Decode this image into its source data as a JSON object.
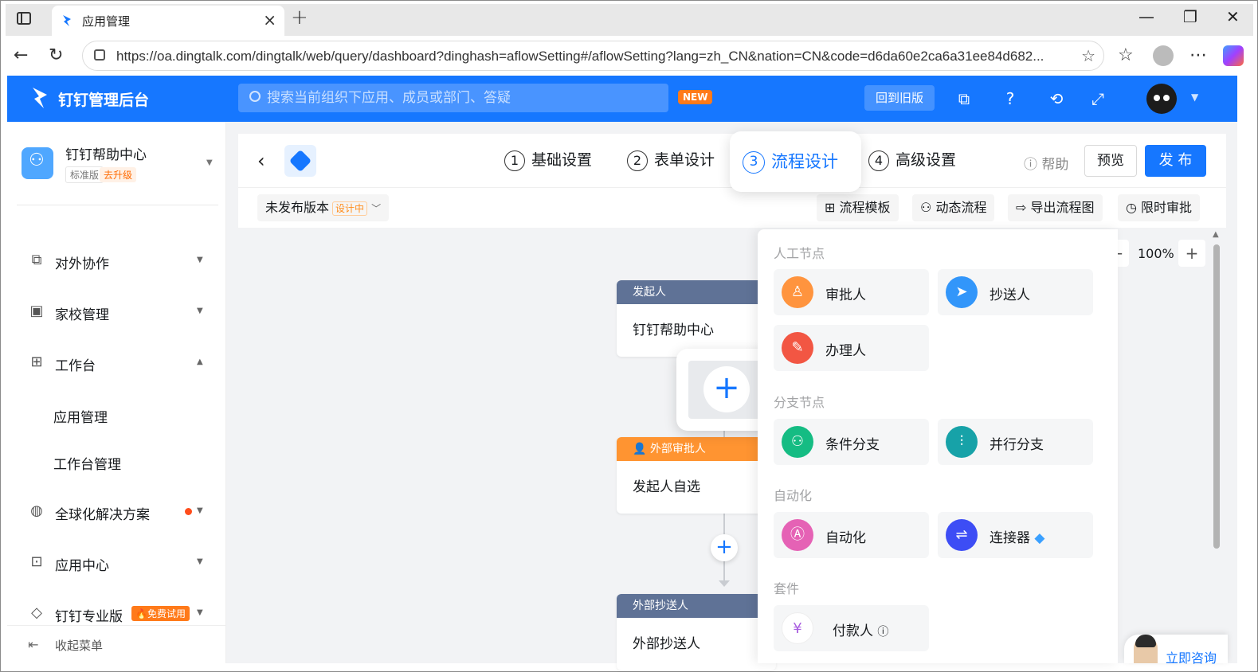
{
  "browser": {
    "tab_title": "应用管理",
    "url": "https://oa.dingtalk.com/dingtalk/web/query/dashboard?dinghash=aflowSetting#/aflowSetting?lang=zh_CN&nation=CN&code=d6da60e2ca6a31ee84d682..."
  },
  "header": {
    "app_title": "钉钉管理后台",
    "search_placeholder": "搜索当前组织下应用、成员或部门、答疑",
    "new_badge": "NEW",
    "old_version_label": "回到旧版",
    "brand_color": "#1677ff"
  },
  "sidebar": {
    "org_name": "钉钉帮助中心",
    "edition": "标准版",
    "upgrade": "去升级",
    "items": [
      {
        "label": "对外协作",
        "icon": "share-icon"
      },
      {
        "label": "家校管理",
        "icon": "school-icon"
      },
      {
        "label": "工作台",
        "icon": "grid-icon"
      },
      {
        "label": "全球化解决方案",
        "icon": "globe-icon"
      },
      {
        "label": "应用中心",
        "icon": "apps-icon"
      },
      {
        "label": "钉钉专业版",
        "icon": "diamond-icon"
      }
    ],
    "sub_items": [
      "应用管理",
      "工作台管理"
    ],
    "trial_badge": "🔥免费试用",
    "collapse_label": "收起菜单"
  },
  "editor": {
    "steps": [
      {
        "num": "1",
        "label": "基础设置"
      },
      {
        "num": "2",
        "label": "表单设计"
      },
      {
        "num": "3",
        "label": "流程设计"
      },
      {
        "num": "4",
        "label": "高级设置"
      }
    ],
    "active_step": 3,
    "help_label": "帮助",
    "preview_label": "预览",
    "publish_label": "发 布",
    "version_label": "未发布版本",
    "version_tag": "设计中",
    "tools": [
      "流程模板",
      "动态流程",
      "导出流程图",
      "限时审批"
    ],
    "zoom": "100%"
  },
  "flow": {
    "nodes": [
      {
        "head": "发起人",
        "body": "钉钉帮助中心",
        "color": "#5f7296"
      },
      {
        "head": "外部审批人",
        "body": "发起人自选",
        "color": "#ff9431"
      },
      {
        "head": "外部抄送人",
        "body": "外部抄送人",
        "color": "#5f7296"
      }
    ]
  },
  "picker": {
    "groups": [
      "人工节点",
      "分支节点",
      "自动化",
      "套件"
    ],
    "items": [
      {
        "label": "审批人",
        "color": "#ff943e",
        "icon": "stamp-icon"
      },
      {
        "label": "抄送人",
        "color": "#3296fa",
        "icon": "send-icon"
      },
      {
        "label": "办理人",
        "color": "#f25643",
        "icon": "edit-icon"
      },
      {
        "label": "条件分支",
        "color": "#15bc83",
        "icon": "branch-icon"
      },
      {
        "label": "并行分支",
        "color": "#17a2a8",
        "icon": "parallel-icon"
      },
      {
        "label": "自动化",
        "color": "#e562b5",
        "icon": "automation-icon"
      },
      {
        "label": "连接器",
        "color": "#3d4df5",
        "icon": "connector-icon"
      },
      {
        "label": "付款人",
        "color": "#a95de0",
        "icon": "payment-icon"
      }
    ]
  },
  "consult_label": "立即咨询"
}
